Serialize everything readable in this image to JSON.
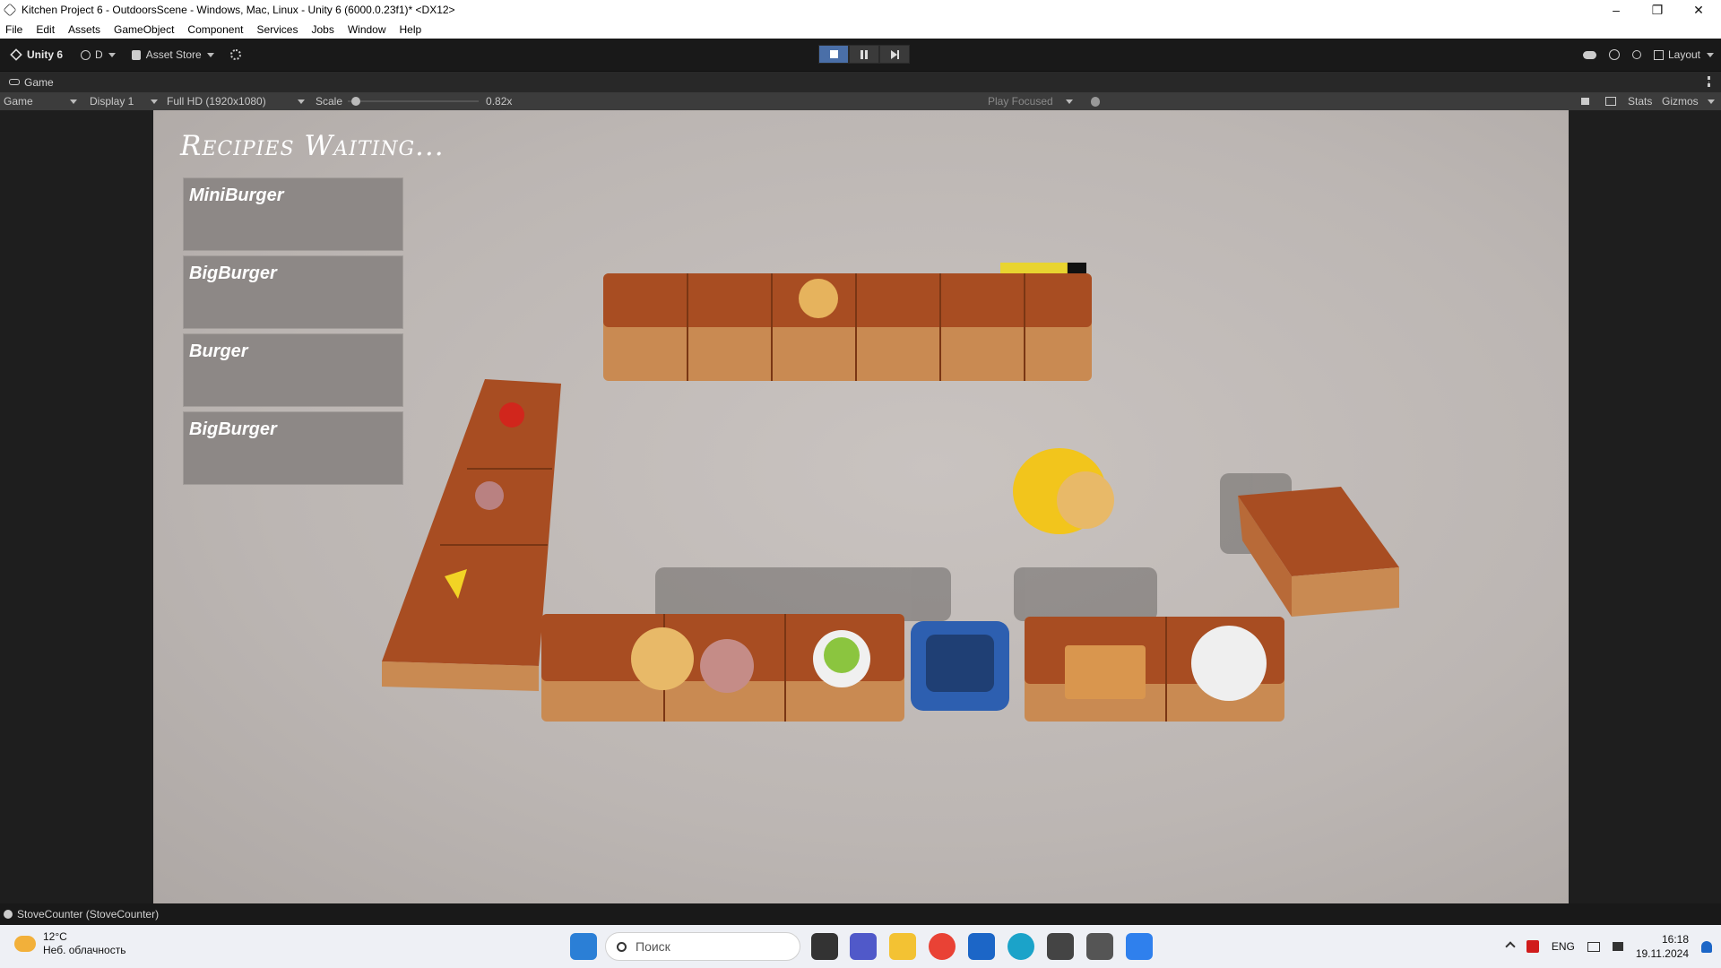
{
  "window": {
    "title": "Kitchen Project 6 - OutdoorsScene - Windows, Mac, Linux - Unity 6 (6000.0.23f1)* <DX12>"
  },
  "menu": [
    "File",
    "Edit",
    "Assets",
    "GameObject",
    "Component",
    "Services",
    "Jobs",
    "Window",
    "Help"
  ],
  "toolbar": {
    "brand": "Unity 6",
    "account": "D",
    "asset_store": "Asset Store",
    "layout": "Layout"
  },
  "tab": {
    "label": "Game"
  },
  "gamebar": {
    "mode": "Game",
    "display": "Display 1",
    "resolution": "Full HD (1920x1080)",
    "scale_label": "Scale",
    "scale_value": "0.82x",
    "play_focused": "Play Focused",
    "stats": "Stats",
    "gizmos": "Gizmos"
  },
  "game": {
    "recipes_title": "Recipies Waiting...",
    "recipes": [
      "MiniBurger",
      "BigBurger",
      "Burger",
      "BigBurger"
    ],
    "stove_progress": 0.78
  },
  "status": {
    "text": "StoveCounter (StoveCounter)"
  },
  "taskbar": {
    "temp": "12°C",
    "weather": "Неб. облачность",
    "search_placeholder": "Поиск",
    "lang": "ENG",
    "time": "16:18",
    "date": "19.11.2024"
  },
  "colors": {
    "accent": "#4a6fa8",
    "counter": "#a24c22",
    "floor": "#c2bcb9"
  }
}
